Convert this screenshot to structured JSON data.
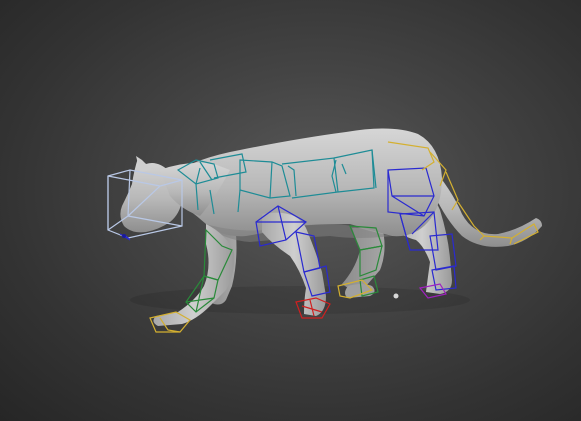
{
  "viewport": {
    "background_color": "#3d3d3d",
    "model_color": "#bdbdbd",
    "rig_colors": {
      "head": "#b9c8e6",
      "spine": "#1e8c96",
      "tail": "#d4b030",
      "front_leg_left": "#2a8a3a",
      "front_paw_left": "#d4b030",
      "front_leg_right": "#2a2ad0",
      "front_paw_right": "#d02020",
      "hind_leg_left": "#2a8a3a",
      "hind_paw_left": "#d4b030",
      "hind_leg_right": "#2a2ad0",
      "hind_paw_right": "#a020c0",
      "pelvis": "#2a2ad0"
    }
  }
}
